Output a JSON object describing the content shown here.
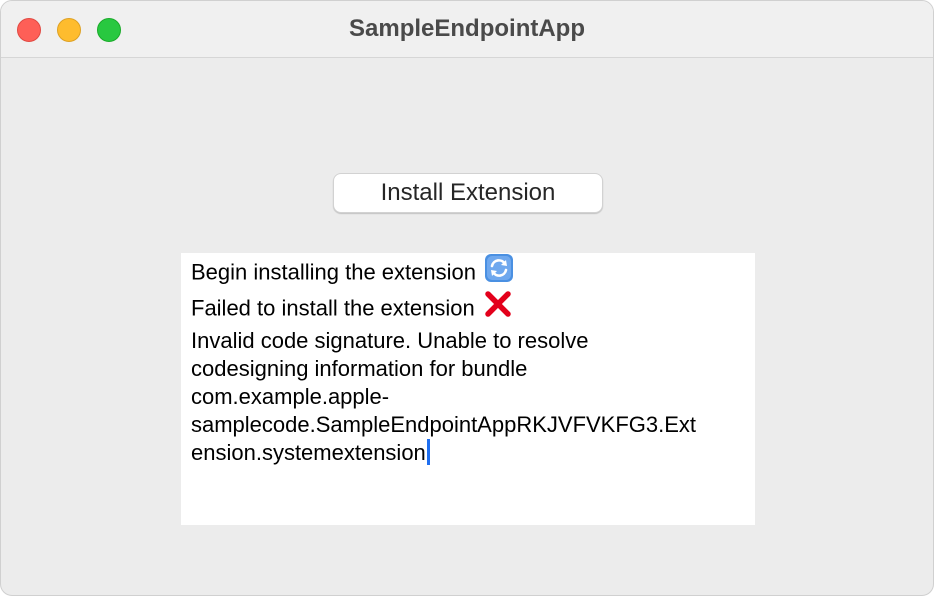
{
  "window": {
    "title": "SampleEndpointApp"
  },
  "main": {
    "install_button_label": "Install Extension"
  },
  "log": {
    "line1": "Begin installing the extension",
    "line1_icon": "refresh-icon",
    "line2": "Failed to install the extension",
    "line2_icon": "cross-mark-icon",
    "error_lines": [
      "Invalid code signature. Unable to resolve",
      "codesigning information for bundle",
      "com.example.apple-",
      "samplecode.SampleEndpointAppRKJVFVKFG3.Ext",
      "ension.systemextension"
    ]
  },
  "colors": {
    "close": "#fe5f57",
    "minimize": "#febc2e",
    "zoom": "#28c840",
    "refresh_icon": "#4a90e2",
    "cross_icon": "#e3001b",
    "caret": "#1f6ff0"
  }
}
